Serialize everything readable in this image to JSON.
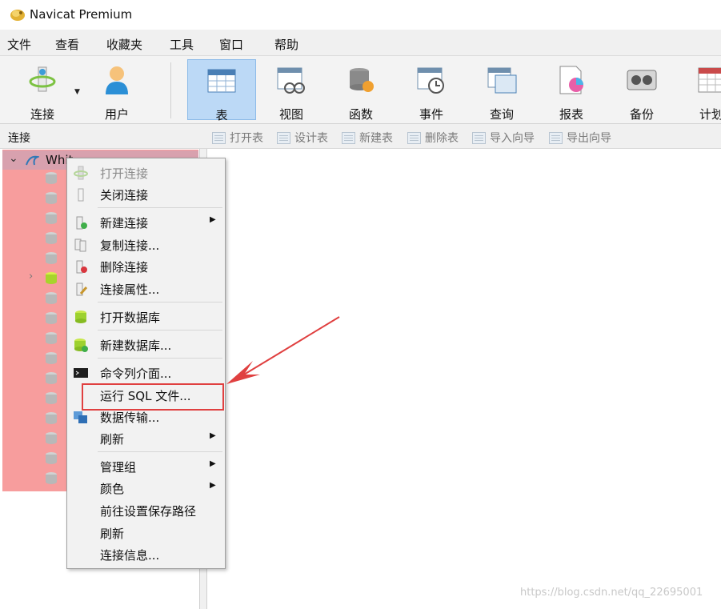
{
  "window": {
    "title": "Navicat Premium"
  },
  "menubar": [
    "文件",
    "查看",
    "收藏夹",
    "工具",
    "窗口",
    "帮助"
  ],
  "toolbar": {
    "items": [
      {
        "label": "连接",
        "icon": "connect-icon"
      },
      {
        "label": "用户",
        "icon": "user-icon"
      },
      {
        "label": "表",
        "icon": "table-icon",
        "active": true
      },
      {
        "label": "视图",
        "icon": "view-icon"
      },
      {
        "label": "函数",
        "icon": "function-icon"
      },
      {
        "label": "事件",
        "icon": "event-icon"
      },
      {
        "label": "查询",
        "icon": "query-icon"
      },
      {
        "label": "报表",
        "icon": "report-icon"
      },
      {
        "label": "备份",
        "icon": "backup-icon"
      },
      {
        "label": "计划",
        "icon": "schedule-icon"
      }
    ]
  },
  "subbar": {
    "section_label": "连接",
    "buttons": [
      "打开表",
      "设计表",
      "新建表",
      "删除表",
      "导入向导",
      "导出向导"
    ]
  },
  "tree": {
    "root_name": "Whit"
  },
  "context_menu": {
    "items": [
      {
        "label": "打开连接",
        "disabled": true
      },
      {
        "label": "关闭连接"
      },
      {
        "label": "新建连接",
        "submenu": true
      },
      {
        "label": "复制连接..."
      },
      {
        "label": "删除连接"
      },
      {
        "label": "连接属性..."
      },
      {
        "label": "打开数据库"
      },
      {
        "label": "新建数据库..."
      },
      {
        "label": "命令列介面..."
      },
      {
        "label": "运行 SQL 文件..."
      },
      {
        "label": "数据传输..."
      },
      {
        "label": "刷新",
        "submenu": true
      },
      {
        "label": "管理组",
        "submenu": true
      },
      {
        "label": "颜色",
        "submenu": true
      },
      {
        "label": "前往设置保存路径"
      },
      {
        "label": "刷新"
      },
      {
        "label": "连接信息..."
      }
    ]
  },
  "watermark": "https://blog.csdn.net/qq_22695001",
  "colors": {
    "highlight_annotation": "#e04040",
    "tree_highlight": "#f79d9d",
    "active_tool": "#bcd9f6"
  }
}
